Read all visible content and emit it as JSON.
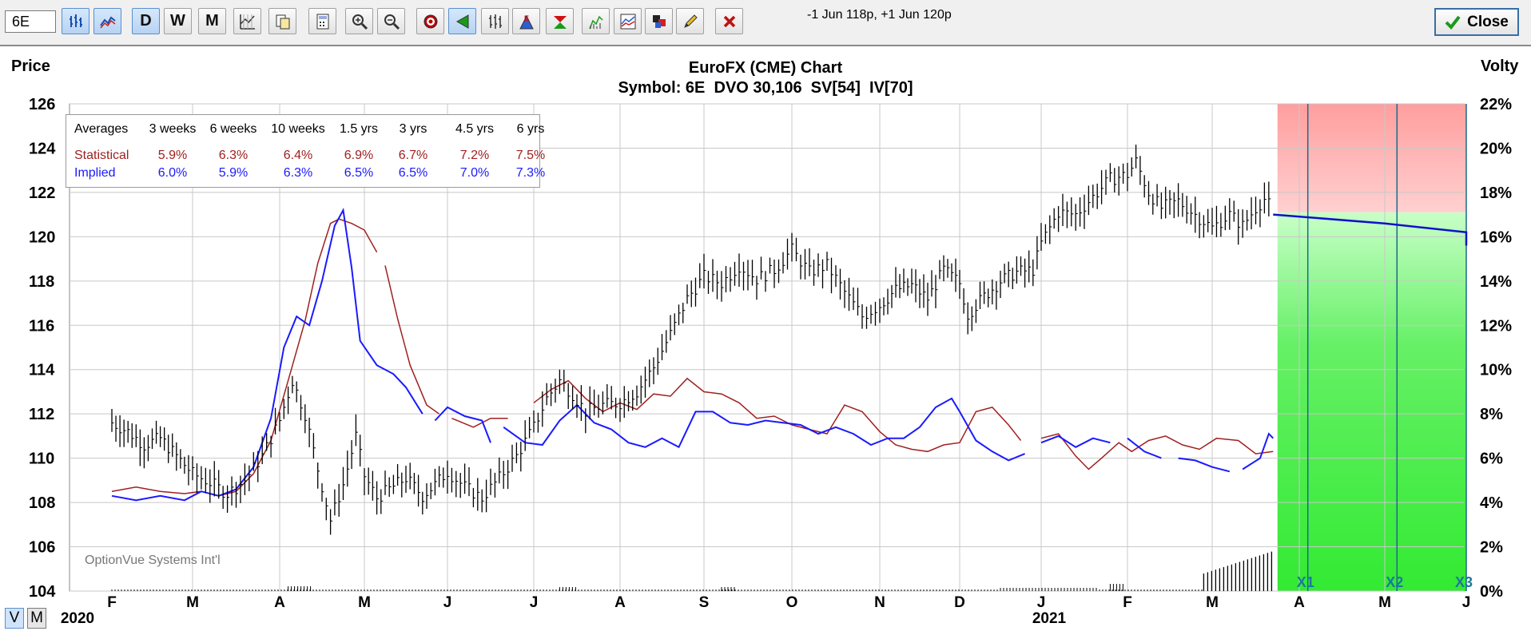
{
  "toolbar": {
    "symbol_value": "6E",
    "buttons": [
      {
        "id": "bar-chart-icon",
        "on": true
      },
      {
        "id": "line-chart-icon",
        "on": true
      },
      {
        "id": "daily",
        "label": "D",
        "on": true
      },
      {
        "id": "weekly",
        "label": "W",
        "on": false
      },
      {
        "id": "monthly",
        "label": "M",
        "on": false
      },
      {
        "id": "grid-icon",
        "on": false
      },
      {
        "id": "copy-icon",
        "on": false
      },
      {
        "id": "calculator-icon",
        "on": false
      },
      {
        "id": "zoom-in-icon",
        "on": false
      },
      {
        "id": "zoom-out-icon",
        "on": false
      },
      {
        "id": "target-icon",
        "on": false
      },
      {
        "id": "triangle-cursor-icon",
        "on": true
      },
      {
        "id": "ohlc-icon",
        "on": false
      },
      {
        "id": "earnings-icon",
        "on": false
      },
      {
        "id": "dividend-icon",
        "on": false
      },
      {
        "id": "volume-chart-icon",
        "on": false
      },
      {
        "id": "volatility-chart-icon",
        "on": false
      },
      {
        "id": "color-palette-icon",
        "on": false
      },
      {
        "id": "pencil-icon",
        "on": false
      },
      {
        "id": "delete-icon",
        "on": false
      }
    ],
    "status_text": "-1 Jun 118p, +1 Jun 120p",
    "close_label": "Close"
  },
  "chart_data": {
    "type": "line",
    "title": "EuroFX (CME) Chart",
    "subtitle": "Symbol: 6E  DVO 30,106  SV[54]  IV[70]",
    "left_axis_label": "Price",
    "right_axis_label": "Volty",
    "y_ticks": [
      "126",
      "124",
      "122",
      "120",
      "118",
      "116",
      "114",
      "112",
      "110",
      "108",
      "106",
      "104"
    ],
    "ylim": [
      104,
      126
    ],
    "y2_ticks": [
      "22%",
      "20%",
      "18%",
      "16%",
      "14%",
      "12%",
      "10%",
      "8%",
      "6%",
      "4%",
      "2%",
      "0%"
    ],
    "y2lim": [
      0,
      22
    ],
    "x_month_labels": [
      "F",
      "M",
      "A",
      "M",
      "J",
      "J",
      "A",
      "S",
      "O",
      "N",
      "D",
      "J",
      "F",
      "M",
      "A",
      "M",
      "J"
    ],
    "year_labels": [
      "2020",
      "2021"
    ],
    "watermark": "OptionVue Systems Int'l",
    "expiry_markers": [
      "X1",
      "X2",
      "X3"
    ],
    "averages_table": {
      "header": [
        "Averages",
        "3 weeks",
        "6 weeks",
        "10 weeks",
        "1.5 yrs",
        "3 yrs",
        "4.5 yrs",
        "6 yrs"
      ],
      "rows": [
        {
          "name": "Statistical",
          "color": "#a02020",
          "values": [
            "5.9%",
            "6.3%",
            "6.4%",
            "6.9%",
            "6.7%",
            "7.2%",
            "7.5%"
          ]
        },
        {
          "name": "Implied",
          "color": "#1a1aff",
          "values": [
            "6.0%",
            "5.9%",
            "6.3%",
            "6.5%",
            "6.5%",
            "7.0%",
            "7.3%"
          ]
        }
      ]
    },
    "price_series": {
      "name": "6E",
      "color": "#000000",
      "points": [
        [
          0,
          111.6
        ],
        [
          0.2,
          111.2
        ],
        [
          0.4,
          110.6
        ],
        [
          0.6,
          110.9
        ],
        [
          0.8,
          110.1
        ],
        [
          1,
          109.3
        ],
        [
          1.2,
          108.9
        ],
        [
          1.4,
          108.4
        ],
        [
          1.6,
          109.0
        ],
        [
          1.8,
          110.1
        ],
        [
          2,
          111.7
        ],
        [
          2.15,
          113.5
        ],
        [
          2.3,
          112.0
        ],
        [
          2.45,
          109.5
        ],
        [
          2.6,
          107.2
        ],
        [
          2.75,
          108.8
        ],
        [
          2.9,
          111.0
        ],
        [
          3.0,
          109.2
        ],
        [
          3.15,
          108.2
        ],
        [
          3.3,
          108.6
        ],
        [
          3.5,
          109.1
        ],
        [
          3.7,
          108.3
        ],
        [
          3.85,
          108.8
        ],
        [
          4,
          109.4
        ],
        [
          4.2,
          108.7
        ],
        [
          4.4,
          108.2
        ],
        [
          4.6,
          109.1
        ],
        [
          4.8,
          110.1
        ],
        [
          5,
          111.4
        ],
        [
          5.15,
          112.7
        ],
        [
          5.3,
          113.5
        ],
        [
          5.45,
          112.9
        ],
        [
          5.6,
          112.1
        ],
        [
          5.8,
          112.4
        ],
        [
          6,
          112.5
        ],
        [
          6.2,
          113.0
        ],
        [
          6.4,
          114.1
        ],
        [
          6.6,
          115.6
        ],
        [
          6.8,
          117.2
        ],
        [
          7,
          118.2
        ],
        [
          7.2,
          117.9
        ],
        [
          7.4,
          118.7
        ],
        [
          7.6,
          118.1
        ],
        [
          7.8,
          118.5
        ],
        [
          8,
          119.4
        ],
        [
          8.2,
          118.4
        ],
        [
          8.4,
          118.7
        ],
        [
          8.6,
          117.5
        ],
        [
          8.8,
          116.4
        ],
        [
          9,
          116.9
        ],
        [
          9.2,
          117.6
        ],
        [
          9.4,
          117.8
        ],
        [
          9.6,
          117.2
        ],
        [
          9.8,
          118.5
        ],
        [
          10,
          117.9
        ],
        [
          10.1,
          116.5
        ],
        [
          10.3,
          117.3
        ],
        [
          10.5,
          118.0
        ],
        [
          10.7,
          118.4
        ],
        [
          10.9,
          118.5
        ],
        [
          11,
          119.7
        ],
        [
          11.2,
          121.1
        ],
        [
          11.4,
          121.0
        ],
        [
          11.6,
          121.8
        ],
        [
          11.8,
          122.6
        ],
        [
          12,
          122.8
        ],
        [
          12.1,
          123.4
        ],
        [
          12.25,
          122.0
        ],
        [
          12.4,
          121.3
        ],
        [
          12.6,
          121.6
        ],
        [
          12.8,
          121.0
        ],
        [
          13,
          120.4
        ],
        [
          13.2,
          121.0
        ],
        [
          13.35,
          120.5
        ],
        [
          13.5,
          121.3
        ],
        [
          13.6,
          121.7
        ],
        [
          13.7,
          121.2
        ]
      ]
    },
    "statistical_vol_series": {
      "name": "Statistical",
      "color": "#a02020",
      "points": [
        [
          0,
          4.5
        ],
        [
          0.3,
          4.7
        ],
        [
          0.6,
          4.5
        ],
        [
          0.9,
          4.4
        ],
        [
          1.1,
          4.5
        ],
        [
          1.3,
          4.3
        ],
        [
          1.5,
          4.5
        ],
        [
          1.7,
          5.3
        ],
        [
          1.9,
          6.8
        ],
        [
          2.1,
          9.5
        ],
        [
          2.3,
          12.2
        ],
        [
          2.45,
          14.8
        ],
        [
          2.6,
          16.6
        ],
        [
          2.7,
          16.8
        ],
        [
          2.85,
          16.6
        ],
        [
          3.0,
          16.3
        ],
        [
          3.15,
          15.3
        ],
        null,
        [
          3.25,
          14.7
        ],
        [
          3.4,
          12.3
        ],
        [
          3.55,
          10.2
        ],
        [
          3.75,
          8.4
        ],
        [
          3.9,
          8.0
        ],
        null,
        [
          4.05,
          7.8
        ],
        [
          4.3,
          7.4
        ],
        [
          4.5,
          7.8
        ],
        [
          4.7,
          7.8
        ],
        null,
        [
          5.0,
          8.5
        ],
        [
          5.2,
          9.1
        ],
        [
          5.4,
          9.5
        ],
        [
          5.6,
          8.7
        ],
        [
          5.8,
          8.1
        ],
        [
          6.0,
          8.5
        ],
        [
          6.2,
          8.2
        ],
        [
          6.4,
          8.9
        ],
        [
          6.6,
          8.8
        ],
        [
          6.8,
          9.6
        ],
        [
          7.0,
          9.0
        ],
        [
          7.2,
          8.9
        ],
        [
          7.4,
          8.5
        ],
        [
          7.6,
          7.8
        ],
        [
          7.8,
          7.9
        ],
        [
          8.0,
          7.5
        ],
        [
          8.2,
          7.3
        ],
        [
          8.4,
          7.1
        ],
        [
          8.6,
          8.4
        ],
        [
          8.8,
          8.1
        ],
        [
          9.0,
          7.2
        ],
        [
          9.2,
          6.6
        ],
        [
          9.4,
          6.4
        ],
        [
          9.6,
          6.3
        ],
        [
          9.8,
          6.6
        ],
        [
          10.0,
          6.7
        ],
        [
          10.2,
          8.1
        ],
        [
          10.4,
          8.3
        ],
        [
          10.6,
          7.5
        ],
        [
          10.75,
          6.8
        ],
        null,
        [
          11.0,
          6.9
        ],
        [
          11.2,
          7.1
        ],
        [
          11.4,
          6.1
        ],
        [
          11.55,
          5.5
        ],
        [
          11.7,
          6.0
        ],
        [
          11.9,
          6.7
        ],
        [
          12.05,
          6.3
        ],
        [
          12.25,
          6.8
        ],
        [
          12.45,
          7.0
        ],
        [
          12.65,
          6.6
        ],
        [
          12.85,
          6.4
        ],
        [
          13.05,
          6.9
        ],
        [
          13.3,
          6.8
        ],
        [
          13.5,
          6.2
        ],
        [
          13.7,
          6.3
        ]
      ]
    },
    "implied_vol_series": {
      "name": "Implied",
      "color": "#1a1aff",
      "points": [
        [
          0,
          4.3
        ],
        [
          0.3,
          4.1
        ],
        [
          0.6,
          4.3
        ],
        [
          0.9,
          4.1
        ],
        [
          1.1,
          4.5
        ],
        [
          1.3,
          4.3
        ],
        [
          1.5,
          4.6
        ],
        [
          1.7,
          5.6
        ],
        [
          1.9,
          7.8
        ],
        [
          2.05,
          11.0
        ],
        [
          2.2,
          12.4
        ],
        [
          2.35,
          12.0
        ],
        [
          2.5,
          14.0
        ],
        [
          2.65,
          16.5
        ],
        [
          2.75,
          17.2
        ],
        [
          2.85,
          14.6
        ],
        [
          2.95,
          11.3
        ],
        [
          3.15,
          10.2
        ],
        [
          3.35,
          9.8
        ],
        [
          3.5,
          9.2
        ],
        [
          3.7,
          8.0
        ],
        null,
        [
          3.85,
          7.7
        ],
        [
          4.0,
          8.3
        ],
        [
          4.2,
          7.9
        ],
        [
          4.4,
          7.7
        ],
        [
          4.5,
          6.7
        ],
        null,
        [
          4.65,
          7.4
        ],
        [
          4.9,
          6.7
        ],
        [
          5.1,
          6.6
        ],
        [
          5.3,
          7.7
        ],
        [
          5.5,
          8.4
        ],
        [
          5.7,
          7.6
        ],
        [
          5.9,
          7.3
        ],
        [
          6.1,
          6.7
        ],
        [
          6.3,
          6.5
        ],
        [
          6.5,
          6.9
        ],
        [
          6.7,
          6.5
        ],
        [
          6.9,
          8.1
        ],
        [
          7.1,
          8.1
        ],
        [
          7.3,
          7.6
        ],
        [
          7.5,
          7.5
        ],
        [
          7.7,
          7.7
        ],
        [
          7.9,
          7.6
        ],
        [
          8.1,
          7.5
        ],
        [
          8.3,
          7.1
        ],
        [
          8.5,
          7.4
        ],
        [
          8.7,
          7.1
        ],
        [
          8.9,
          6.6
        ],
        [
          9.1,
          6.9
        ],
        [
          9.3,
          6.9
        ],
        [
          9.5,
          7.4
        ],
        [
          9.7,
          8.3
        ],
        [
          9.9,
          8.7
        ],
        [
          10.0,
          8.1
        ],
        [
          10.2,
          6.8
        ],
        [
          10.4,
          6.3
        ],
        [
          10.6,
          5.9
        ],
        [
          10.8,
          6.2
        ],
        null,
        [
          11.0,
          6.7
        ],
        [
          11.2,
          7.0
        ],
        [
          11.4,
          6.5
        ],
        [
          11.6,
          6.9
        ],
        [
          11.8,
          6.7
        ],
        null,
        [
          12.0,
          6.9
        ],
        [
          12.2,
          6.3
        ],
        [
          12.4,
          6.0
        ],
        null,
        [
          12.6,
          6.0
        ],
        [
          12.8,
          5.9
        ],
        [
          13.0,
          5.6
        ],
        [
          13.2,
          5.4
        ],
        null,
        [
          13.35,
          5.5
        ],
        [
          13.55,
          6.0
        ],
        [
          13.65,
          7.1
        ],
        [
          13.7,
          6.9
        ]
      ]
    },
    "projection_line": {
      "color": "#1010cc",
      "points": [
        [
          13.7,
          121.0
        ],
        [
          15.0,
          120.6
        ],
        [
          16.0,
          120.2
        ],
        [
          16.7,
          119.6
        ],
        [
          16.7,
          119.6
        ]
      ]
    },
    "projection_zone": {
      "above_color": "#ff7b7b",
      "below_color": "#33ee33"
    },
    "volume_bars_note": "volume shown as small bars near bottom"
  }
}
